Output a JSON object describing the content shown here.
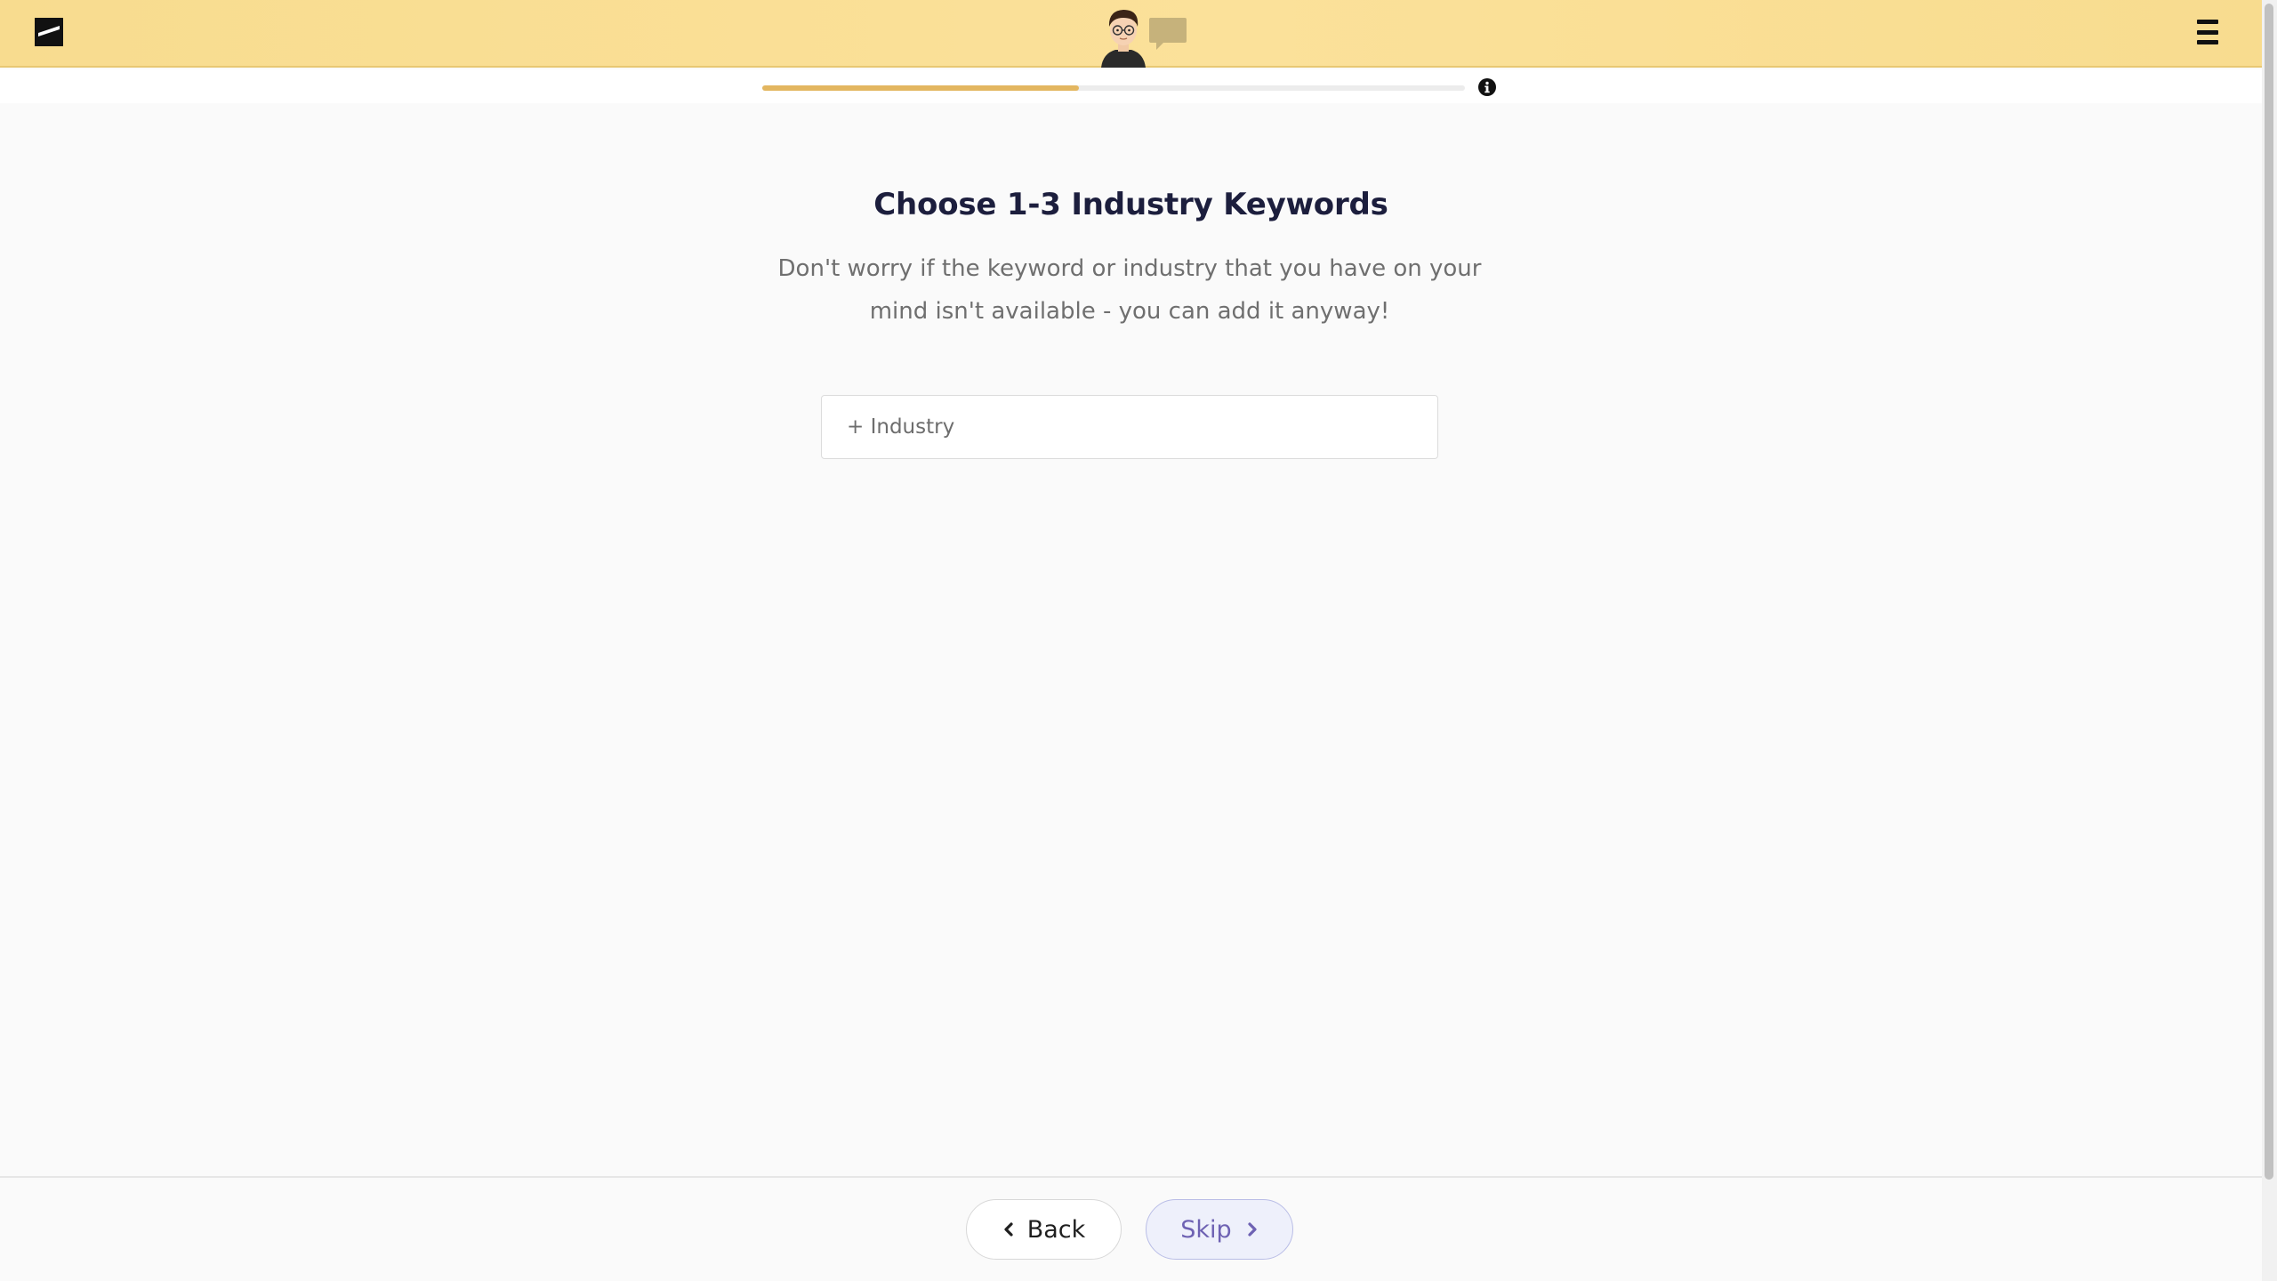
{
  "header": {
    "logo_icon": "brand-logo-icon",
    "avatar_icon": "assistant-avatar-icon",
    "chat_icon": "chat-bubble-icon",
    "menu_icon": "hamburger-menu-icon"
  },
  "progress": {
    "fraction": 0.45,
    "info_icon": "info-circle-icon"
  },
  "main": {
    "title": "Choose 1-3 Industry Keywords",
    "subtitle": "Don't worry if the keyword or industry that you have on your mind isn't available - you can add it anyway!",
    "industry_input": {
      "placeholder": "+ Industry",
      "value": ""
    }
  },
  "footer": {
    "back_label": "Back",
    "skip_label": "Skip"
  },
  "colors": {
    "header_bg": "#fbe19a",
    "progress_fill": "#e3b660",
    "title": "#1c1e3d",
    "skip_accent": "#6e62b3"
  }
}
